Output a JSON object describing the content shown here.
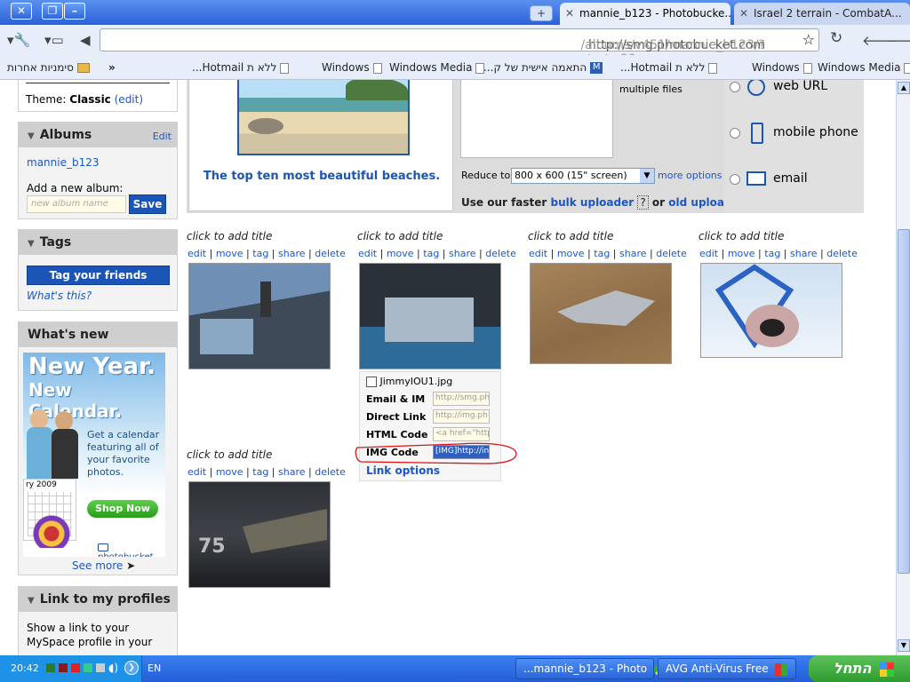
{
  "browser": {
    "tabs": [
      {
        "label": "mannie_b123 - Photobucke...",
        "active": true
      },
      {
        "label": "Israel 2 terrain - CombatA...",
        "active": false
      }
    ],
    "url_domain": "http://smg.photobucket.com",
    "url_path": "/albums/v451/mannie_b123/?start=80",
    "bookmarks_other": "סימניות אחרות",
    "bookmarks_chevron": "»",
    "bookmarks": [
      "...Hotmail ללא ת",
      "Windows",
      "Windows Media",
      "...התאמה אישית של ק",
      "...Hotmail ללא ת",
      "Windows",
      "Windows Media"
    ]
  },
  "sidebar": {
    "theme_label": "Theme:",
    "theme_value": "Classic",
    "theme_edit": "(edit)",
    "albums": {
      "title": "Albums",
      "edit": "Edit",
      "album": "mannie_b123",
      "add_label": "Add a new album:",
      "placeholder": "new album name",
      "save": "Save"
    },
    "tags": {
      "title": "Tags",
      "button": "Tag your friends",
      "whats_this": "What's this?"
    },
    "whats_new": {
      "title": "What's new",
      "ad_line1": "New Year.",
      "ad_line2": "New Calendar.",
      "ad_text": "Get a calendar featuring all of your favorite photos.",
      "ad_button": "Shop Now",
      "ad_brand": "photobucket",
      "ad_date": "ry 2009",
      "see_more": "See more"
    },
    "profiles": {
      "title": "Link to my profiles",
      "text": "Show a link to your MySpace profile in your"
    }
  },
  "upload": {
    "promo_caption": "The top ten most beautiful beaches.",
    "multiple_files": "multiple files",
    "reduce_label": "Reduce to:",
    "reduce_value": "800 x 600 (15\" screen)",
    "more_options": "more options",
    "faster_text": "Use our faster",
    "bulk_uploader": "bulk uploader",
    "help_q": "?",
    "or_text": "or",
    "old_uploader": "old uploader",
    "sources": [
      "web URL",
      "mobile phone",
      "email"
    ]
  },
  "gallery": {
    "title_prompt": "click to add title",
    "actions": [
      "edit",
      "move",
      "tag",
      "share",
      "delete"
    ],
    "share_box": {
      "filename": "JimmyIOU1.jpg",
      "rows": [
        {
          "label": "Email & IM",
          "value": "http://smg.ph"
        },
        {
          "label": "Direct Link",
          "value": "http://img.ph"
        },
        {
          "label": "HTML Code",
          "value": "<a href=\"http"
        },
        {
          "label": "IMG Code",
          "value": "[IMG]http://in"
        }
      ],
      "link_options": "Link options"
    },
    "tail_number": "75"
  },
  "taskbar": {
    "time": "20:42",
    "lang": "EN",
    "tasks": [
      "...mannie_b123 - Photo",
      "AVG Anti-Virus Free"
    ],
    "start": "התחל"
  },
  "colors": {
    "link": "#1b56c7",
    "accent_button": "#1b55b5",
    "xp_blue": "#2a62d8",
    "start_green": "#2f9b2f",
    "annotation_red": "#e01010"
  }
}
